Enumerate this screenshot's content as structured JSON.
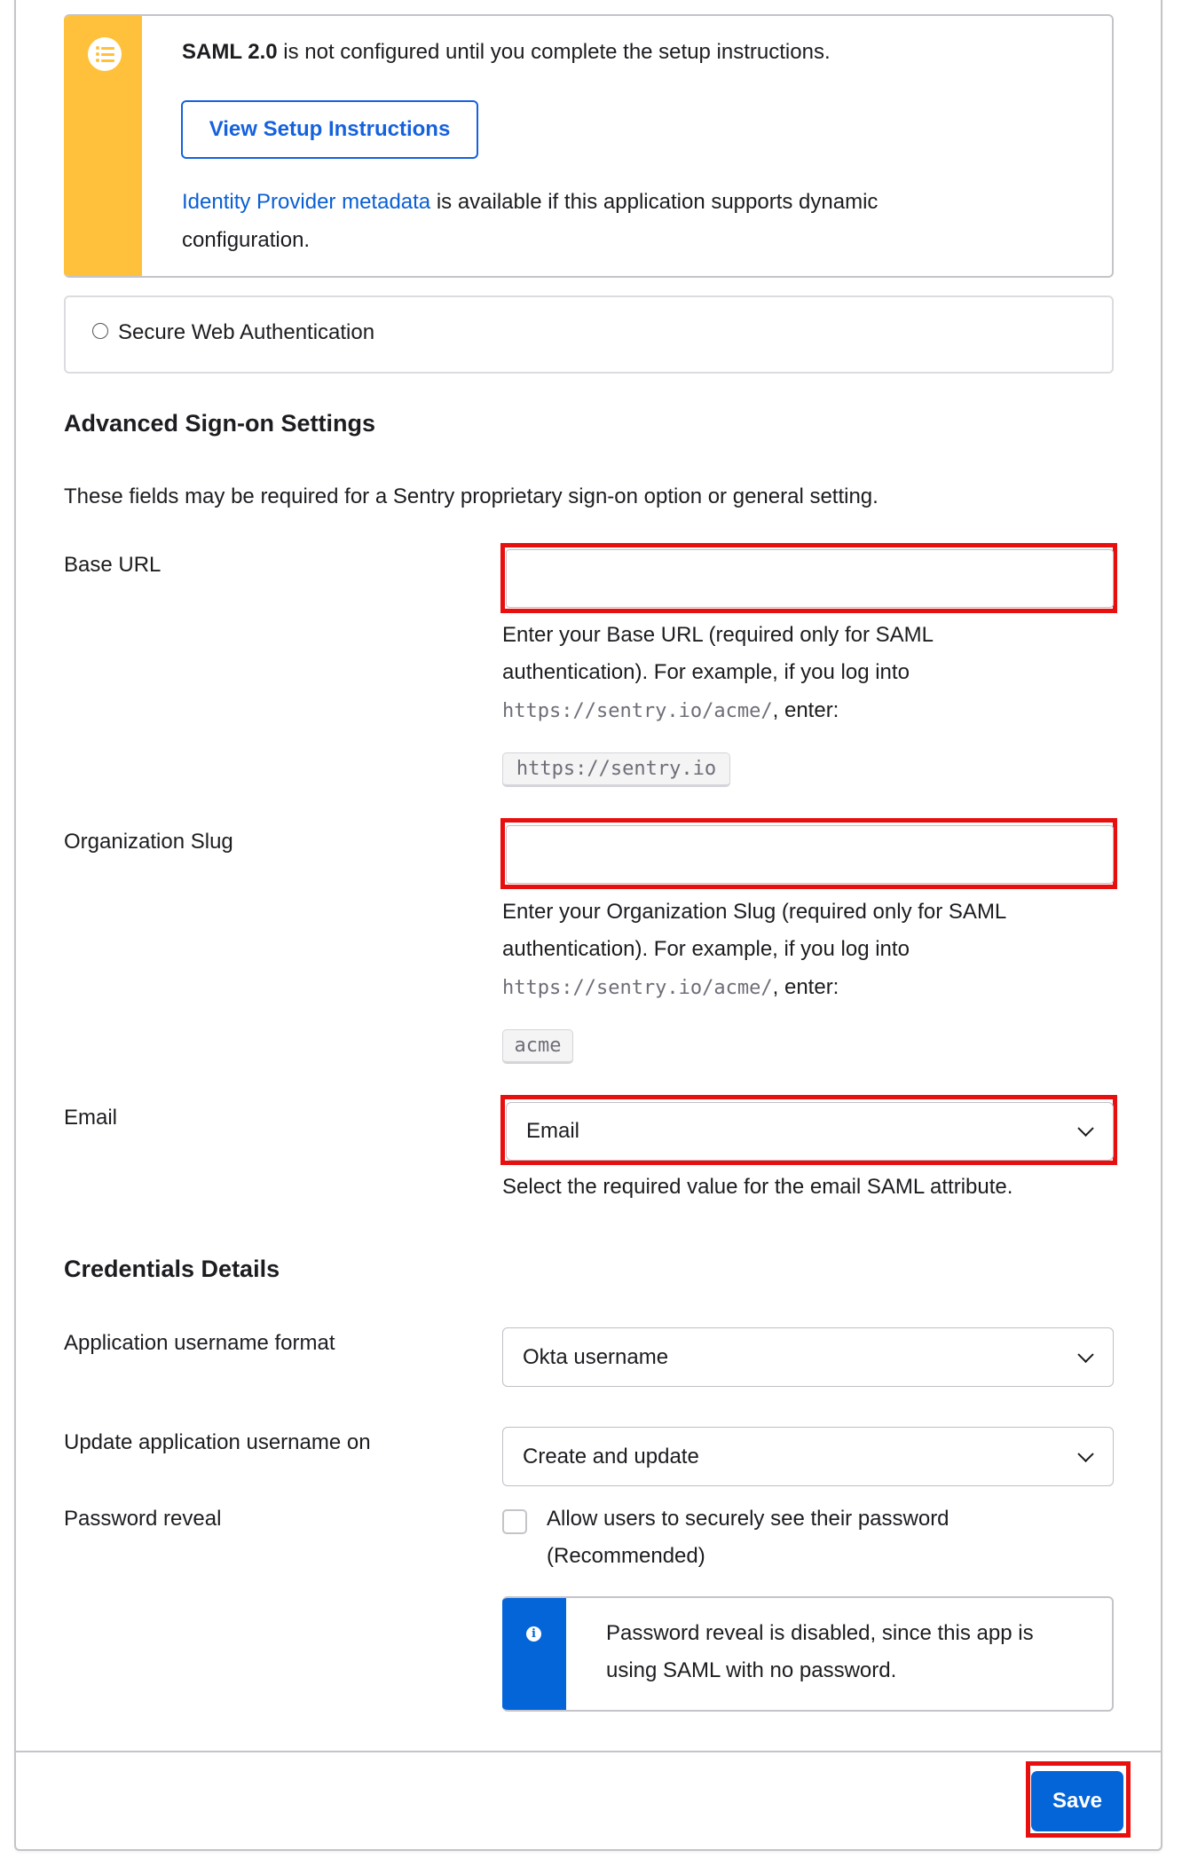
{
  "callout": {
    "icon": "list-icon",
    "message_bold": "SAML 2.0",
    "message_rest": " is not configured until you complete the setup instructions.",
    "button_label": "View Setup Instructions",
    "metadata_link": "Identity Provider metadata",
    "metadata_rest_line1": " is available if this application supports dynamic",
    "metadata_rest_line2": "configuration.",
    "accent_color": "#ffc13b"
  },
  "swa_option": {
    "label": "Secure Web Authentication",
    "selected": false
  },
  "advanced": {
    "heading": "Advanced Sign-on Settings",
    "description": "These fields may be required for a Sentry proprietary sign-on option or general setting.",
    "base_url": {
      "label": "Base URL",
      "value": "",
      "help_line1": "Enter your Base URL (required only for SAML",
      "help_line2": "authentication). For example, if you log into",
      "help_example_url": "https://sentry.io/acme/",
      "help_enter": ", enter:",
      "example_value": "https://sentry.io"
    },
    "org_slug": {
      "label": "Organization Slug",
      "value": "",
      "help_line1": "Enter your Organization Slug (required only for SAML",
      "help_line2": "authentication). For example, if you log into",
      "help_example_url": "https://sentry.io/acme/",
      "help_enter": ", enter:",
      "example_value": "acme"
    },
    "email": {
      "label": "Email",
      "selected": "Email",
      "help": "Select the required value for the email SAML attribute."
    }
  },
  "credentials": {
    "heading": "Credentials Details",
    "username_format": {
      "label": "Application username format",
      "selected": "Okta username"
    },
    "update_on": {
      "label": "Update application username on",
      "selected": "Create and update"
    },
    "password_reveal": {
      "label": "Password reveal",
      "checkbox_line1": "Allow users to securely see their password",
      "checkbox_line2": "(Recommended)",
      "checked": false,
      "info_line1": "Password reveal is disabled, since this app is",
      "info_line2": "using SAML with no password.",
      "info_color": "#0465d9"
    }
  },
  "footer": {
    "save_label": "Save"
  },
  "highlight_color": "#e8100f"
}
